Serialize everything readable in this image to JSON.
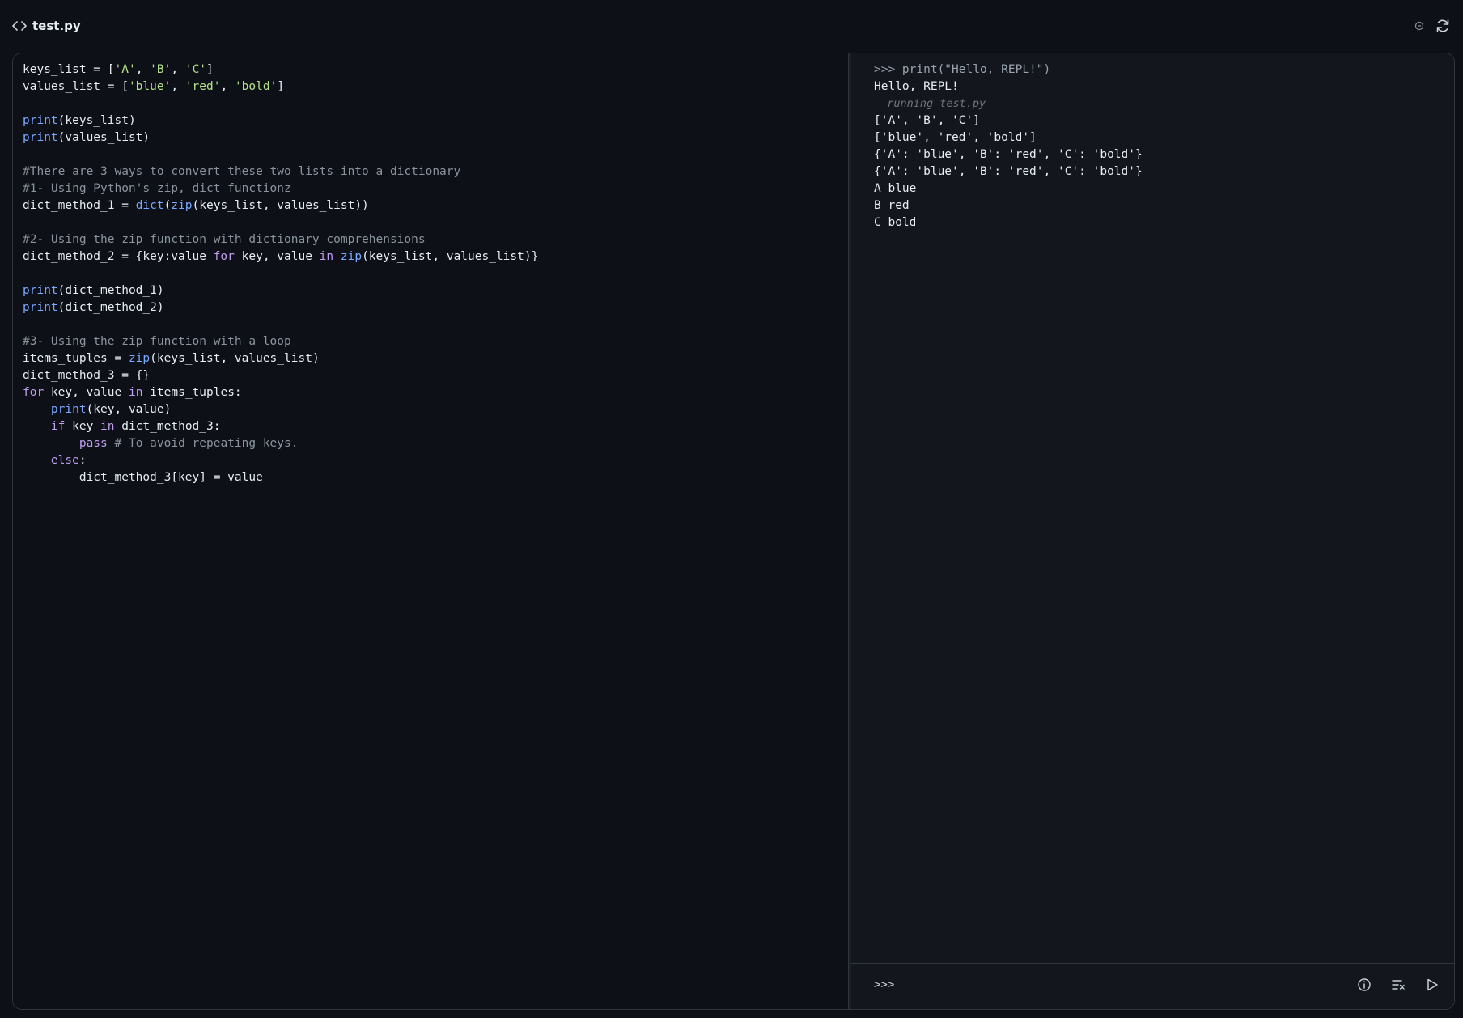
{
  "header": {
    "file_name": "test.py"
  },
  "editor": {
    "lines": [
      "keys_list = ['A', 'B', 'C']",
      "values_list = ['blue', 'red', 'bold']",
      "",
      "print(keys_list)",
      "print(values_list)",
      "",
      "#There are 3 ways to convert these two lists into a dictionary",
      "#1- Using Python's zip, dict functionz",
      "dict_method_1 = dict(zip(keys_list, values_list))",
      "",
      "#2- Using the zip function with dictionary comprehensions",
      "dict_method_2 = {key:value for key, value in zip(keys_list, values_list)}",
      "",
      "print(dict_method_1)",
      "print(dict_method_2)",
      "",
      "#3- Using the zip function with a loop",
      "items_tuples = zip(keys_list, values_list)",
      "dict_method_3 = {}",
      "for key, value in items_tuples:",
      "    print(key, value)",
      "    if key in dict_method_3:",
      "        pass # To avoid repeating keys.",
      "    else:",
      "        dict_method_3[key] = value"
    ]
  },
  "repl": {
    "history": [
      {
        "kind": "prompt",
        "text": ">>> print(\"Hello, REPL!\")"
      },
      {
        "kind": "output",
        "text": "Hello, REPL!"
      },
      {
        "kind": "running",
        "text": "— running test.py —"
      },
      {
        "kind": "output",
        "text": "['A', 'B', 'C']"
      },
      {
        "kind": "output",
        "text": "['blue', 'red', 'bold']"
      },
      {
        "kind": "output",
        "text": "{'A': 'blue', 'B': 'red', 'C': 'bold'}"
      },
      {
        "kind": "output",
        "text": "{'A': 'blue', 'B': 'red', 'C': 'bold'}"
      },
      {
        "kind": "output",
        "text": "A blue"
      },
      {
        "kind": "output",
        "text": "B red"
      },
      {
        "kind": "output",
        "text": "C bold"
      }
    ],
    "input_prompt": ">>>",
    "input_value": ""
  },
  "icons": {
    "file": "code-brackets-icon",
    "status": "circle-status-icon",
    "refresh": "refresh-icon",
    "info": "info-icon",
    "clear": "clear-output-icon",
    "run": "run-play-icon"
  }
}
